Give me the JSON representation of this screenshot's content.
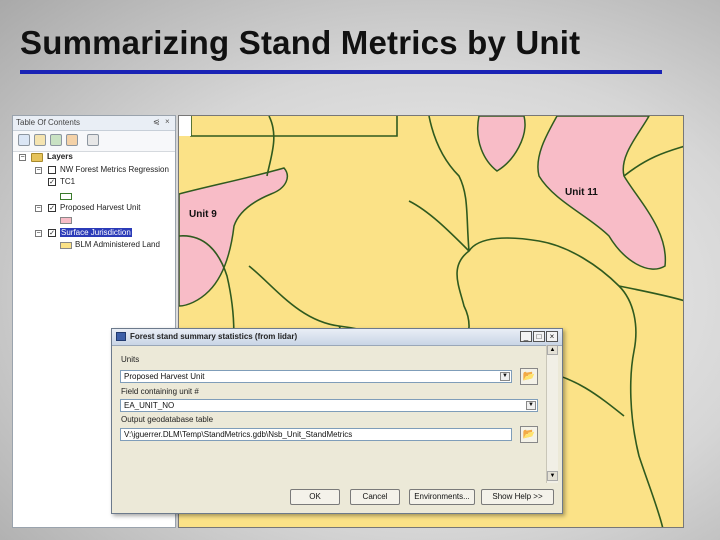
{
  "slide": {
    "title": "Summarizing Stand Metrics by Unit"
  },
  "toc": {
    "panel_title": "Table Of Contents",
    "pin_glyph": "⩿",
    "close_glyph": "×",
    "toolbar_icons": [
      "list-by-drawing-order-icon",
      "list-by-source-icon",
      "list-by-visibility-icon",
      "list-by-selection-icon",
      "options-icon"
    ],
    "root_label": "Layers",
    "layers": [
      {
        "label": "NW Forest Metrics Regression",
        "checked": false,
        "expand": "−"
      },
      {
        "label": "TC1",
        "checked": true,
        "expand": ""
      },
      {
        "label": "Proposed Harvest Unit",
        "checked": true,
        "expand": "−"
      },
      {
        "label": "Surface Jurisdiction",
        "checked": true,
        "expand": "−",
        "selected": true
      }
    ],
    "legend": [
      {
        "label": "",
        "color": "#f8bcc7"
      },
      {
        "label": "BLM Administered Land",
        "color": "#fbe287"
      }
    ]
  },
  "map": {
    "labels": [
      "Unit 9",
      "Unit 11"
    ],
    "colors": {
      "land": "#fbe287",
      "harvest_unit": "#f8bcc7",
      "boundary": "#2f5a1f"
    }
  },
  "dialog": {
    "title": "Forest stand summary statistics (from lidar)",
    "window_buttons": [
      "_",
      "□",
      "×"
    ],
    "units_label": "Units",
    "units_value": "Proposed Harvest Unit",
    "field_label": "Field containing unit #",
    "field_value": "EA_UNIT_NO",
    "output_label": "Output geodatabase table",
    "output_value": "V:\\jguerrer.DLM\\Temp\\StandMetrics.gdb\\Nsb_Unit_StandMetrics",
    "buttons": {
      "ok": "OK",
      "cancel": "Cancel",
      "environments": "Environments...",
      "help": "Show Help >>"
    }
  }
}
